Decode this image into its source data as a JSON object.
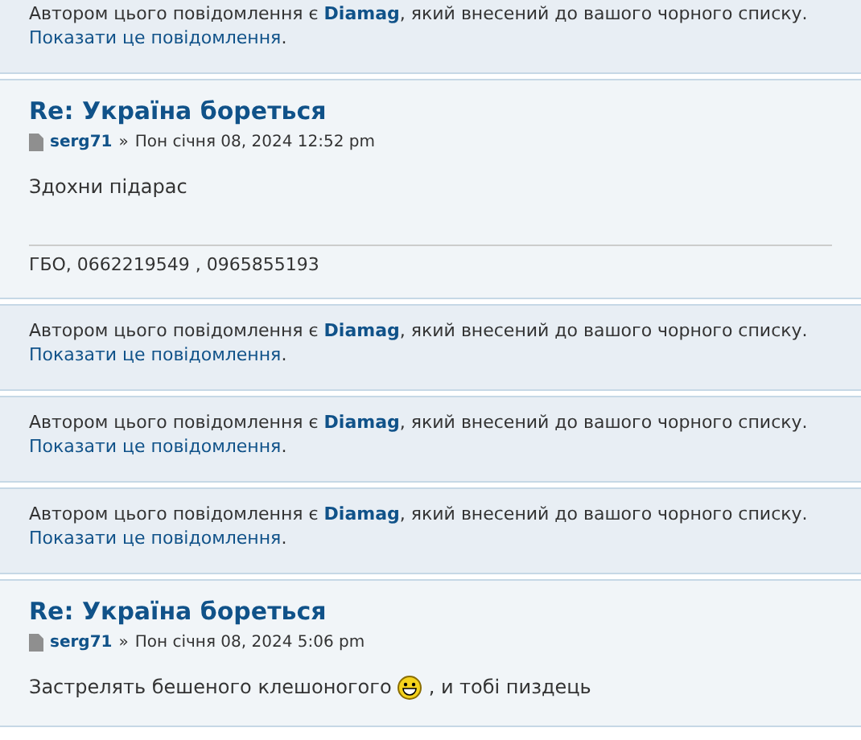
{
  "posts": [
    {
      "kind": "ignored",
      "notice_before": "Автором цього повідомлення є ",
      "author": "Diamag",
      "notice_after": ", який внесений до вашого чорного списку.",
      "link": "Показати це повідомлення",
      "link_after": "."
    },
    {
      "kind": "post",
      "title": "Re: Україна бореться",
      "author": "serg71",
      "separator": "»",
      "date": "Пон січня 08, 2024 12:52 pm",
      "body": [
        {
          "kind": "text",
          "text": "Здохни підарас"
        }
      ],
      "signature": "ГБО, 0662219549 , 0965855193"
    },
    {
      "kind": "ignored",
      "notice_before": "Автором цього повідомлення є ",
      "author": "Diamag",
      "notice_after": ", який внесений до вашого чорного списку.",
      "link": "Показати це повідомлення",
      "link_after": "."
    },
    {
      "kind": "ignored",
      "notice_before": "Автором цього повідомлення є ",
      "author": "Diamag",
      "notice_after": ", який внесений до вашого чорного списку.",
      "link": "Показати це повідомлення",
      "link_after": "."
    },
    {
      "kind": "ignored",
      "notice_before": "Автором цього повідомлення є ",
      "author": "Diamag",
      "notice_after": ", який внесений до вашого чорного списку.",
      "link": "Показати це повідомлення",
      "link_after": "."
    },
    {
      "kind": "post",
      "title": "Re: Україна бореться",
      "author": "serg71",
      "separator": "»",
      "date": "Пон січня 08, 2024 5:06 pm",
      "body": [
        {
          "kind": "text",
          "text": "Застрелять бешеного клешоногого"
        },
        {
          "kind": "smiley"
        },
        {
          "kind": "text",
          "text": ", и тобі пиздець"
        }
      ]
    }
  ]
}
